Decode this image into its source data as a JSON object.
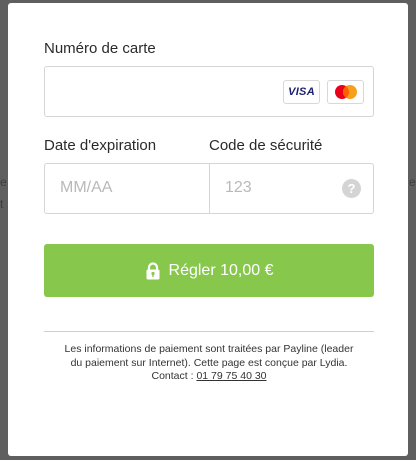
{
  "form": {
    "card_number_label": "Numéro de carte",
    "expiry_label": "Date d'expiration",
    "expiry_placeholder": "MM/AA",
    "cvc_label": "Code de sécurité",
    "cvc_placeholder": "123",
    "help_glyph": "?",
    "visa_logo_text": "VISA",
    "mastercard_logo_text": "MasterCard"
  },
  "pay_button": {
    "label": "Régler 10,00 €",
    "color": "#87c84c"
  },
  "footer": {
    "line1": "Les informations de paiement sont traitées par Payline (leader",
    "line2": "du paiement sur Internet). Cette page est conçue par Lydia.",
    "contact_label": "Contact : ",
    "phone": "01 79 75 40 30"
  },
  "background": {
    "left_edge_fragment_1": "e",
    "left_edge_fragment_2": "t",
    "right_edge_fragment": "e"
  },
  "icons": [
    "visa-logo",
    "mastercard-logo",
    "help-icon",
    "lock-icon"
  ]
}
